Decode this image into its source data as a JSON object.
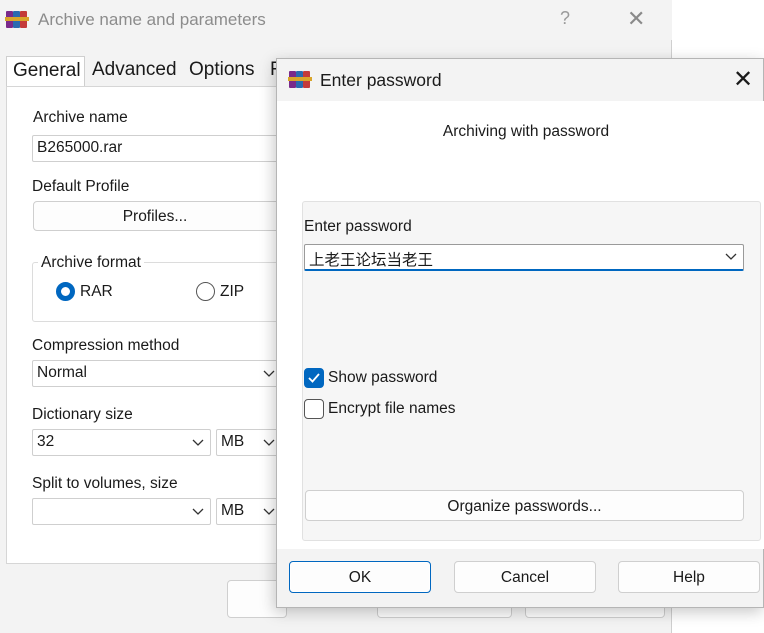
{
  "back_dialog": {
    "title": "Archive name and parameters",
    "help_glyph": "?",
    "close_glyph": "✕",
    "tabs": [
      "General",
      "Advanced",
      "Options",
      "F"
    ],
    "archive_name_label": "Archive name",
    "archive_name_value": "B265000.rar",
    "default_profile_label": "Default Profile",
    "profiles_button": "Profiles...",
    "archive_format_label": "Archive format",
    "format_rar": "RAR",
    "format_zip": "ZIP",
    "compression_method_label": "Compression method",
    "compression_method_value": "Normal",
    "dictionary_size_label": "Dictionary size",
    "dictionary_size_value": "32",
    "dictionary_unit": "MB",
    "split_label": "Split to volumes, size",
    "split_value": "",
    "split_unit": "MB"
  },
  "front_dialog": {
    "title": "Enter password",
    "close_glyph": "✕",
    "subtitle": "Archiving with password",
    "password_label": "Enter password",
    "password_value": "上老王论坛当老王",
    "show_password_label": "Show password",
    "show_password_checked": true,
    "encrypt_names_label": "Encrypt file names",
    "encrypt_names_checked": false,
    "organize_button": "Organize passwords...",
    "ok_button": "OK",
    "cancel_button": "Cancel",
    "help_button": "Help"
  },
  "colors": {
    "accent": "#0067c0",
    "window_bg": "#f3f3f3",
    "border": "#cfcfcf"
  }
}
